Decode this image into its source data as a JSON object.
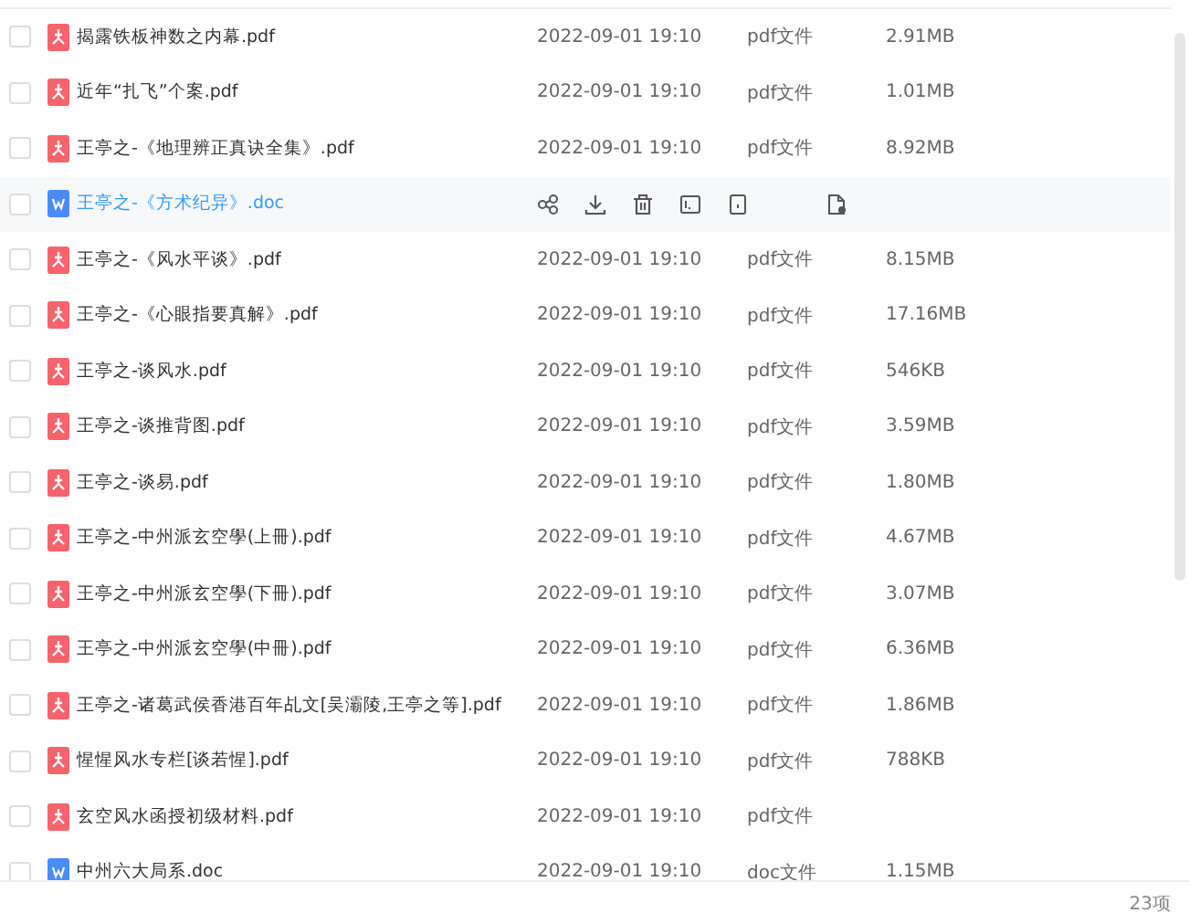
{
  "rows": [
    {
      "kind": "pdf",
      "name": "揭露铁板神数之内幕.pdf",
      "date": "2022-09-01 19:10",
      "type": "pdf文件",
      "size": "2.91MB",
      "checked": false,
      "hovered": false
    },
    {
      "kind": "pdf",
      "name": "近年“扎飞”个案.pdf",
      "date": "2022-09-01 19:10",
      "type": "pdf文件",
      "size": "1.01MB",
      "checked": false,
      "hovered": false
    },
    {
      "kind": "pdf",
      "name": "王亭之-《地理辨正真诀全集》.pdf",
      "date": "2022-09-01 19:10",
      "type": "pdf文件",
      "size": "8.92MB",
      "checked": false,
      "hovered": false
    },
    {
      "kind": "doc",
      "name": "王亭之-《方术纪异》.doc",
      "checked": false,
      "hovered": true
    },
    {
      "kind": "pdf",
      "name": "王亭之-《风水平谈》.pdf",
      "date": "2022-09-01 19:10",
      "type": "pdf文件",
      "size": "8.15MB",
      "checked": false,
      "hovered": false
    },
    {
      "kind": "pdf",
      "name": "王亭之-《心眼指要真解》.pdf",
      "date": "2022-09-01 19:10",
      "type": "pdf文件",
      "size": "17.16MB",
      "checked": false,
      "hovered": false
    },
    {
      "kind": "pdf",
      "name": "王亭之-谈风水.pdf",
      "date": "2022-09-01 19:10",
      "type": "pdf文件",
      "size": "546KB",
      "checked": false,
      "hovered": false
    },
    {
      "kind": "pdf",
      "name": "王亭之-谈推背图.pdf",
      "date": "2022-09-01 19:10",
      "type": "pdf文件",
      "size": "3.59MB",
      "checked": false,
      "hovered": false
    },
    {
      "kind": "pdf",
      "name": "王亭之-谈易.pdf",
      "date": "2022-09-01 19:10",
      "type": "pdf文件",
      "size": "1.80MB",
      "checked": false,
      "hovered": false
    },
    {
      "kind": "pdf",
      "name": "王亭之-中州派玄空學(上冊).pdf",
      "date": "2022-09-01 19:10",
      "type": "pdf文件",
      "size": "4.67MB",
      "checked": false,
      "hovered": false
    },
    {
      "kind": "pdf",
      "name": "王亭之-中州派玄空學(下冊).pdf",
      "date": "2022-09-01 19:10",
      "type": "pdf文件",
      "size": "3.07MB",
      "checked": false,
      "hovered": false
    },
    {
      "kind": "pdf",
      "name": "王亭之-中州派玄空學(中冊).pdf",
      "date": "2022-09-01 19:10",
      "type": "pdf文件",
      "size": "6.36MB",
      "checked": false,
      "hovered": false
    },
    {
      "kind": "pdf",
      "name": "王亭之-诸葛武侯香港百年乩文[吴灞陵,王亭之等].pdf",
      "date": "2022-09-01 19:10",
      "type": "pdf文件",
      "size": "1.86MB",
      "checked": false,
      "hovered": false
    },
    {
      "kind": "pdf",
      "name": "惺惺风水专栏[谈若惺].pdf",
      "date": "2022-09-01 19:10",
      "type": "pdf文件",
      "size": "788KB",
      "checked": false,
      "hovered": false
    },
    {
      "kind": "pdf",
      "name": "玄空风水函授初级材料.pdf",
      "date": "2022-09-01 19:10",
      "type": "pdf文件",
      "checked": false,
      "hovered": false
    },
    {
      "kind": "doc",
      "name": "中州六大局系.doc",
      "date": "2022-09-01 19:10",
      "type": "doc文件",
      "size": "1.15MB",
      "checked": false,
      "hovered": false
    }
  ],
  "footer": {
    "count": "23项"
  }
}
